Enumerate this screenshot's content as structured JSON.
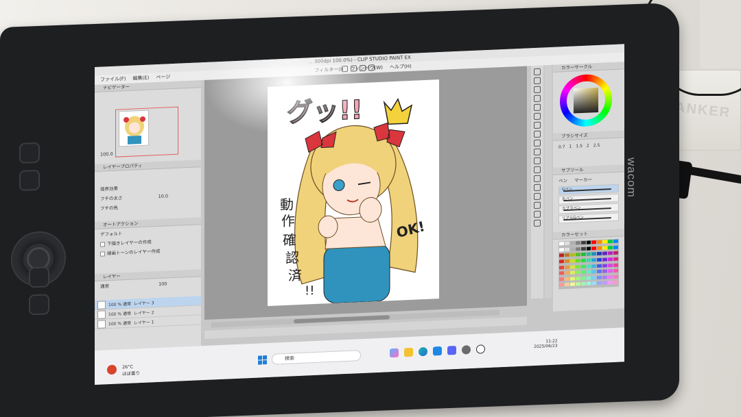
{
  "app": {
    "title": "... 300dpi 100.0%) - CLIP STUDIO PAINT EX",
    "menu": [
      "ファイル(F)",
      "編集(E)",
      "ページ",
      "フィルター(I)",
      "ウィンドウ(W)",
      "ヘルプ(H)"
    ]
  },
  "device": {
    "brand": "wacom",
    "background_logo": "ANKER"
  },
  "left_panels": {
    "navigator_title": "ナビゲーター",
    "zoom_value": "100.0",
    "layer_property_title": "レイヤープロパティ",
    "layer_property_rows": [
      {
        "label": "境界効果",
        "value": ""
      },
      {
        "label": "フチの太さ",
        "value": "10.0"
      },
      {
        "label": "フチの色",
        "value": ""
      }
    ],
    "auto_action_title": "オートアクション",
    "auto_action_set": "デフォルト",
    "auto_actions": [
      "下描きレイヤーの作成",
      "線画トーンのレイヤー作成"
    ],
    "layer_title": "レイヤー",
    "blend_mode": "通常",
    "opacity": "100",
    "layers": [
      {
        "percent": "100 % 通常",
        "name": "レイヤー 3",
        "selected": true
      },
      {
        "percent": "100 % 通常",
        "name": "レイヤー 2",
        "selected": false
      },
      {
        "percent": "100 % 通常",
        "name": "レイヤー 1",
        "selected": false
      }
    ]
  },
  "artwork": {
    "title_text": "グッ!!",
    "side_text": [
      "動",
      "作",
      "確",
      "認",
      "済",
      "!!"
    ],
    "bubble_text": "OK!",
    "colors": {
      "hair": "#f0d27a",
      "ribbon": "#d9363e",
      "dress": "#2f93bd",
      "crown": "#f4d23c",
      "title": "#f4a6b6"
    }
  },
  "right_panels": {
    "color_wheel_title": "カラーサークル",
    "brush_size_title": "ブラシサイズ",
    "brush_size_values": [
      "0.7",
      "1",
      "1.5",
      "2",
      "2.5"
    ],
    "subtool_title": "サブツール",
    "subtool_tabs": [
      "ペン",
      "マーカー"
    ],
    "subtool_items": [
      "Gペン",
      "丸ペン",
      "カブラペン",
      "リアルGペン"
    ],
    "color_set_title": "カラーセット",
    "main_color": "#c8b04a"
  },
  "taskbar": {
    "search_placeholder": "検索",
    "weather_temp": "26°C",
    "weather_text": "ほぼ曇り",
    "time": "11:22",
    "date": "2025/06/23",
    "apps": [
      "copilot",
      "file-explorer",
      "edge",
      "ms-store",
      "discord",
      "onedrive",
      "clip-studio"
    ]
  }
}
